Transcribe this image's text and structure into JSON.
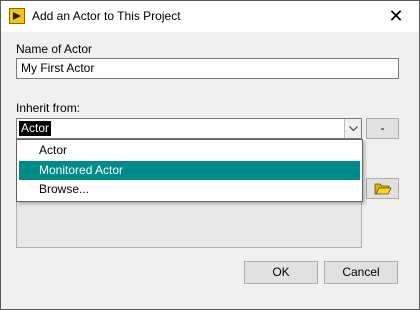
{
  "window": {
    "title": "Add an Actor to This Project",
    "close_glyph": "✕"
  },
  "form": {
    "name_label": "Name of Actor",
    "name_value": "My First Actor",
    "inherit_label": "Inherit from:",
    "inherit_selected": "Actor",
    "side_button_label": "-"
  },
  "dropdown": {
    "options": [
      "Actor",
      "Monitored Actor",
      "Browse..."
    ],
    "highlighted": "Monitored Actor"
  },
  "buttons": {
    "ok_label": "OK",
    "cancel_label": "Cancel"
  },
  "icons": {
    "app": "labview-app-icon",
    "combo_arrow": "chevron-down-icon",
    "browse": "folder-open-icon",
    "close": "close-icon"
  },
  "colors": {
    "highlight": "#008b8b",
    "selected_text_bg": "#000000",
    "dialog_bg": "#f0f0f0"
  }
}
